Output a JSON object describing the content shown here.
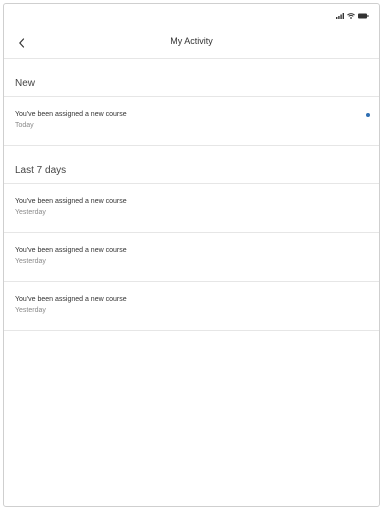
{
  "status_bar": {
    "icons": [
      "signal-icon",
      "wifi-icon",
      "battery-icon"
    ]
  },
  "header": {
    "back_icon": "chevron-left-icon",
    "title": "My Activity"
  },
  "sections": [
    {
      "title": "New",
      "items": [
        {
          "title": "You've been assigned a new course",
          "time": "Today",
          "unread": true
        }
      ]
    },
    {
      "title": "Last 7 days",
      "items": [
        {
          "title": "You've been assigned a new course",
          "time": "Yesterday",
          "unread": false
        },
        {
          "title": "You've been assigned a new course",
          "time": "Yesterday",
          "unread": false
        },
        {
          "title": "You've been assigned a new course",
          "time": "Yesterday",
          "unread": false
        }
      ]
    }
  ],
  "colors": {
    "accent": "#2f6fb3",
    "divider": "#e6e6e6",
    "text_primary": "#333333",
    "text_secondary": "#8a8a8a"
  }
}
